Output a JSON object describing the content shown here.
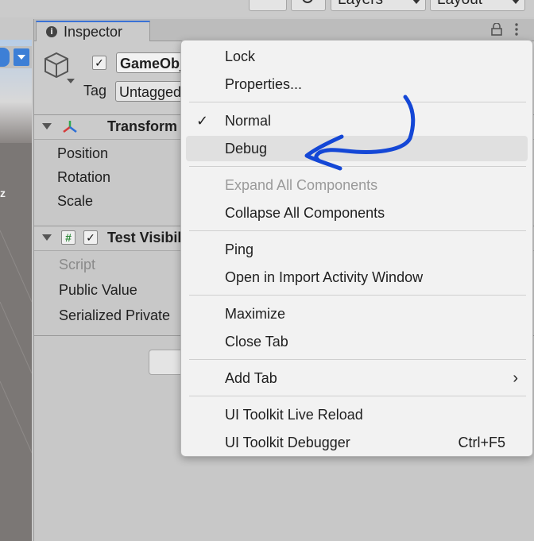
{
  "toolbar": {
    "layers_label": "Layers",
    "layout_label": "Layout"
  },
  "scene": {
    "axis_label": "z",
    "menu_dots": "⋮"
  },
  "inspector": {
    "tab_label": "Inspector",
    "info_glyph": "i",
    "gameobject_name": "GameObject",
    "tag_label": "Tag",
    "tag_value": "Untagged",
    "transform": {
      "title": "Transform",
      "properties": [
        "Position",
        "Rotation",
        "Scale"
      ]
    },
    "script_component": {
      "title": "Test Visibility",
      "script_glyph": "#",
      "script_label": "Script",
      "properties": [
        "Public Value",
        "Serialized Private"
      ]
    }
  },
  "context_menu": {
    "items": [
      {
        "label": "Lock"
      },
      {
        "label": "Properties..."
      },
      {
        "label": "Normal",
        "checked": true
      },
      {
        "label": "Debug"
      },
      {
        "label": "Expand All Components",
        "disabled": true
      },
      {
        "label": "Collapse All Components"
      },
      {
        "label": "Ping"
      },
      {
        "label": "Open in Import Activity Window"
      },
      {
        "label": "Maximize"
      },
      {
        "label": "Close Tab"
      },
      {
        "label": "Add Tab"
      },
      {
        "label": "UI Toolkit Live Reload"
      },
      {
        "label": "UI Toolkit Debugger",
        "shortcut": "Ctrl+F5"
      }
    ],
    "check_glyph": "✓",
    "submenu_glyph": "›"
  },
  "colors": {
    "annotation_stroke": "#1447d6",
    "tab_accent": "#3a72d6"
  }
}
